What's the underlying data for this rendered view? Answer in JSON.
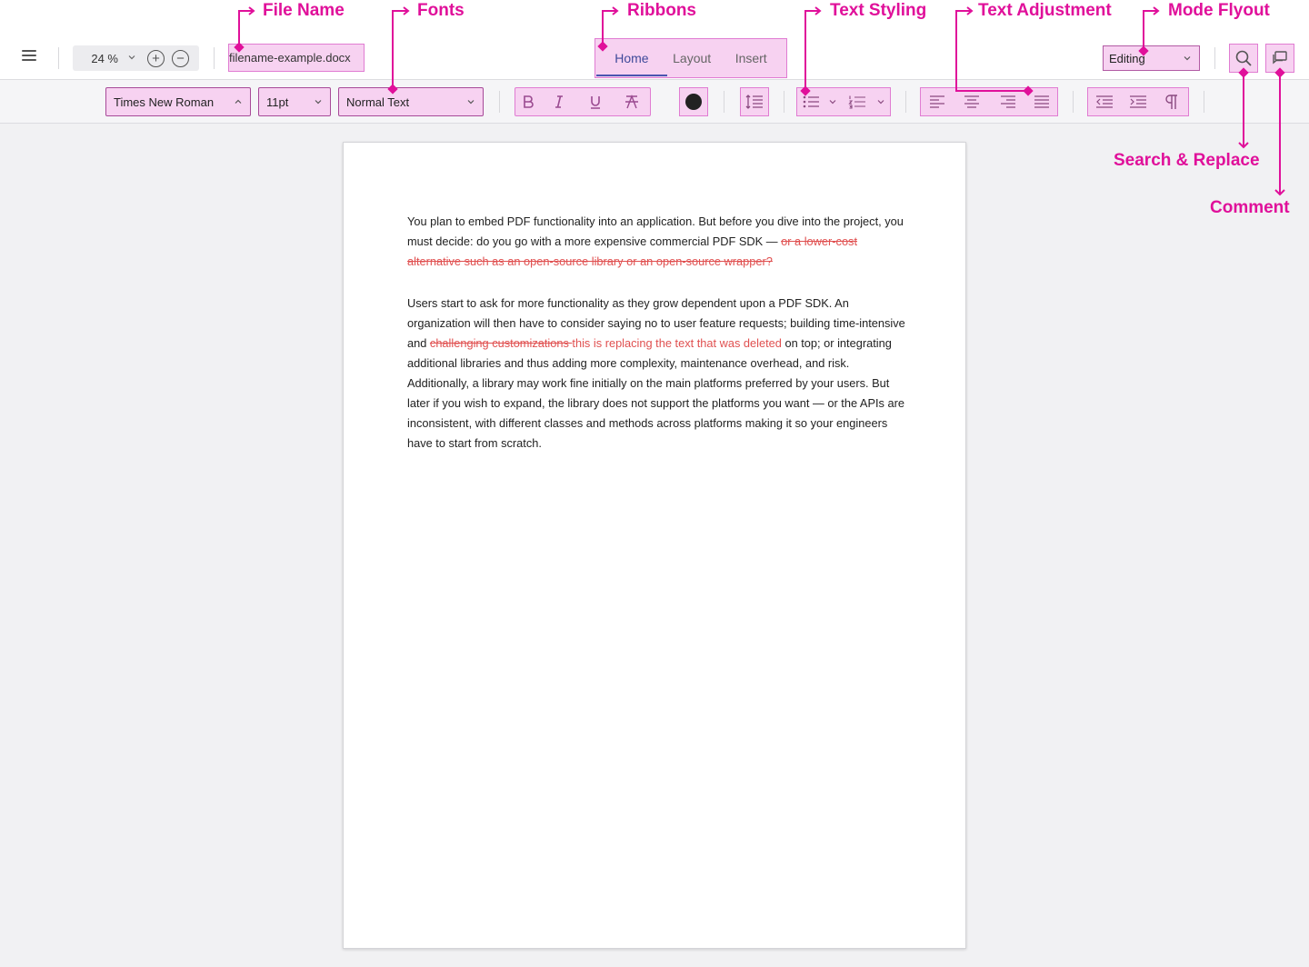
{
  "header": {
    "zoom": "24 %",
    "file_name": "filename-example.docx",
    "tabs": [
      {
        "label": "Home",
        "active": true
      },
      {
        "label": "Layout",
        "active": false
      },
      {
        "label": "Insert",
        "active": false
      }
    ],
    "mode": "Editing"
  },
  "toolbar": {
    "font_family": "Times New Roman",
    "font_size": "11pt",
    "text_style": "Normal Text",
    "text_color": "#222222"
  },
  "document": {
    "para1_normal": "You plan to embed PDF functionality into an application. But before you dive into the project, you must decide: do you go with a more expensive commercial PDF SDK — ",
    "para1_deleted": "or a lower-cost alternative such as an open-source library or an open-source wrapper?",
    "para2_before": "Users start to ask for more functionality as they grow dependent upon a PDF SDK. An organization will then have to consider saying no to user feature requests; building time-intensive and ",
    "para2_deleted": "challenging customizations ",
    "para2_inserted": "this is replacing the text that was deleted",
    "para2_after": " on top; or integrating additional libraries and thus adding more complexity, maintenance overhead, and risk. Additionally, a library may work fine initially on the main platforms preferred by your users. But later if you wish to expand, the library does not support the platforms you want — or the APIs are inconsistent, with different classes and methods across platforms making it so your engineers have to start from scratch."
  },
  "annotations": {
    "file_name": "File Name",
    "fonts": "Fonts",
    "ribbons": "Ribbons",
    "text_styling": "Text Styling",
    "text_adjustment": "Text Adjustment",
    "mode_flyout": "Mode Flyout",
    "search_replace": "Search & Replace",
    "comment": "Comment"
  },
  "colors": {
    "annotation": "#e0109a",
    "highlight_fill": "#f7d2f1",
    "tracked_change": "#e05050",
    "active_tab": "#4a55b0"
  },
  "icons": [
    "hamburger-menu-icon",
    "zoom-in-icon",
    "zoom-out-icon",
    "bold-icon",
    "italic-icon",
    "underline-icon",
    "strikethrough-icon",
    "text-color-icon",
    "line-spacing-icon",
    "bulleted-list-icon",
    "numbered-list-icon",
    "align-left-icon",
    "align-center-icon",
    "align-right-icon",
    "justify-icon",
    "decrease-indent-icon",
    "increase-indent-icon",
    "pilcrow-icon",
    "search-icon",
    "comment-icon"
  ]
}
